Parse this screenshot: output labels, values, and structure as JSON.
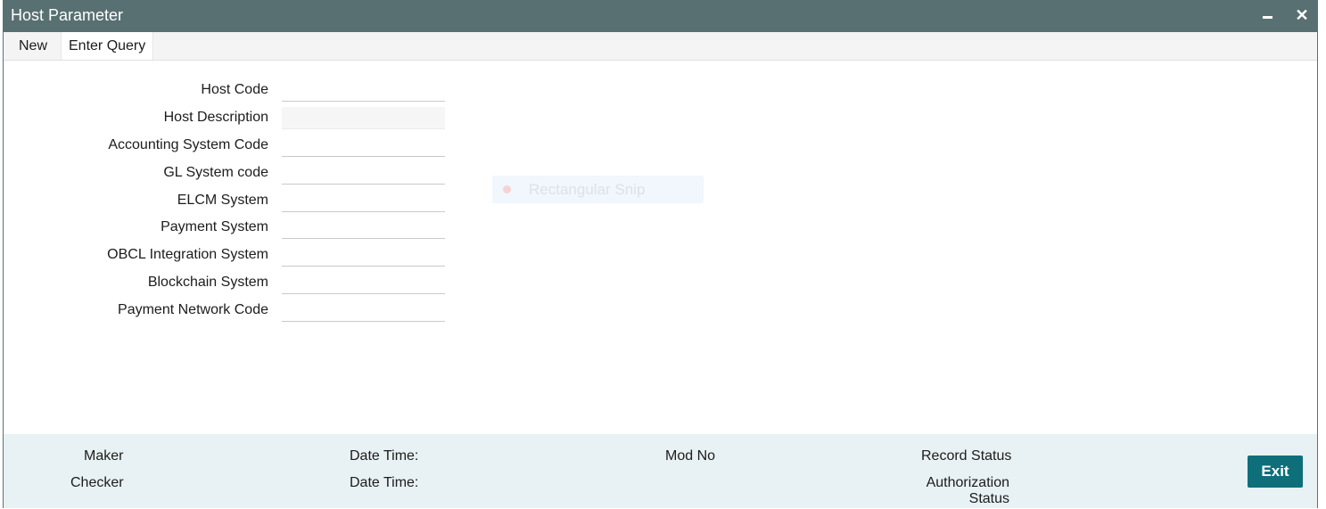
{
  "window": {
    "title": "Host Parameter",
    "minimize_icon": "minimize-icon",
    "close_icon": "close-icon",
    "close_glyph": "✕"
  },
  "toolbar": {
    "new_label": "New",
    "enter_query_label": "Enter Query"
  },
  "form": {
    "fields": [
      {
        "label": "Host Code",
        "value": ""
      },
      {
        "label": "Host Description",
        "value": "",
        "disabled": true
      },
      {
        "label": "Accounting System Code",
        "value": ""
      },
      {
        "label": "GL System code",
        "value": ""
      },
      {
        "label": "ELCM System",
        "value": ""
      },
      {
        "label": "Payment System",
        "value": ""
      },
      {
        "label": "OBCL Integration System",
        "value": ""
      },
      {
        "label": "Blockchain System",
        "value": ""
      },
      {
        "label": "Payment Network Code",
        "value": ""
      }
    ]
  },
  "overlay": {
    "snip_label": "Rectangular Snip"
  },
  "footer": {
    "maker_label": "Maker",
    "checker_label": "Checker",
    "maker_datetime_label": "Date Time:",
    "checker_datetime_label": "Date Time:",
    "mod_no_label": "Mod No",
    "record_status_label": "Record Status",
    "authorization_label": "Authorization",
    "authorization_status_label": "Status",
    "exit_label": "Exit"
  },
  "colors": {
    "titlebar": "#587072",
    "footer": "#e8f1f3",
    "exit_button": "#0e6f7b"
  }
}
